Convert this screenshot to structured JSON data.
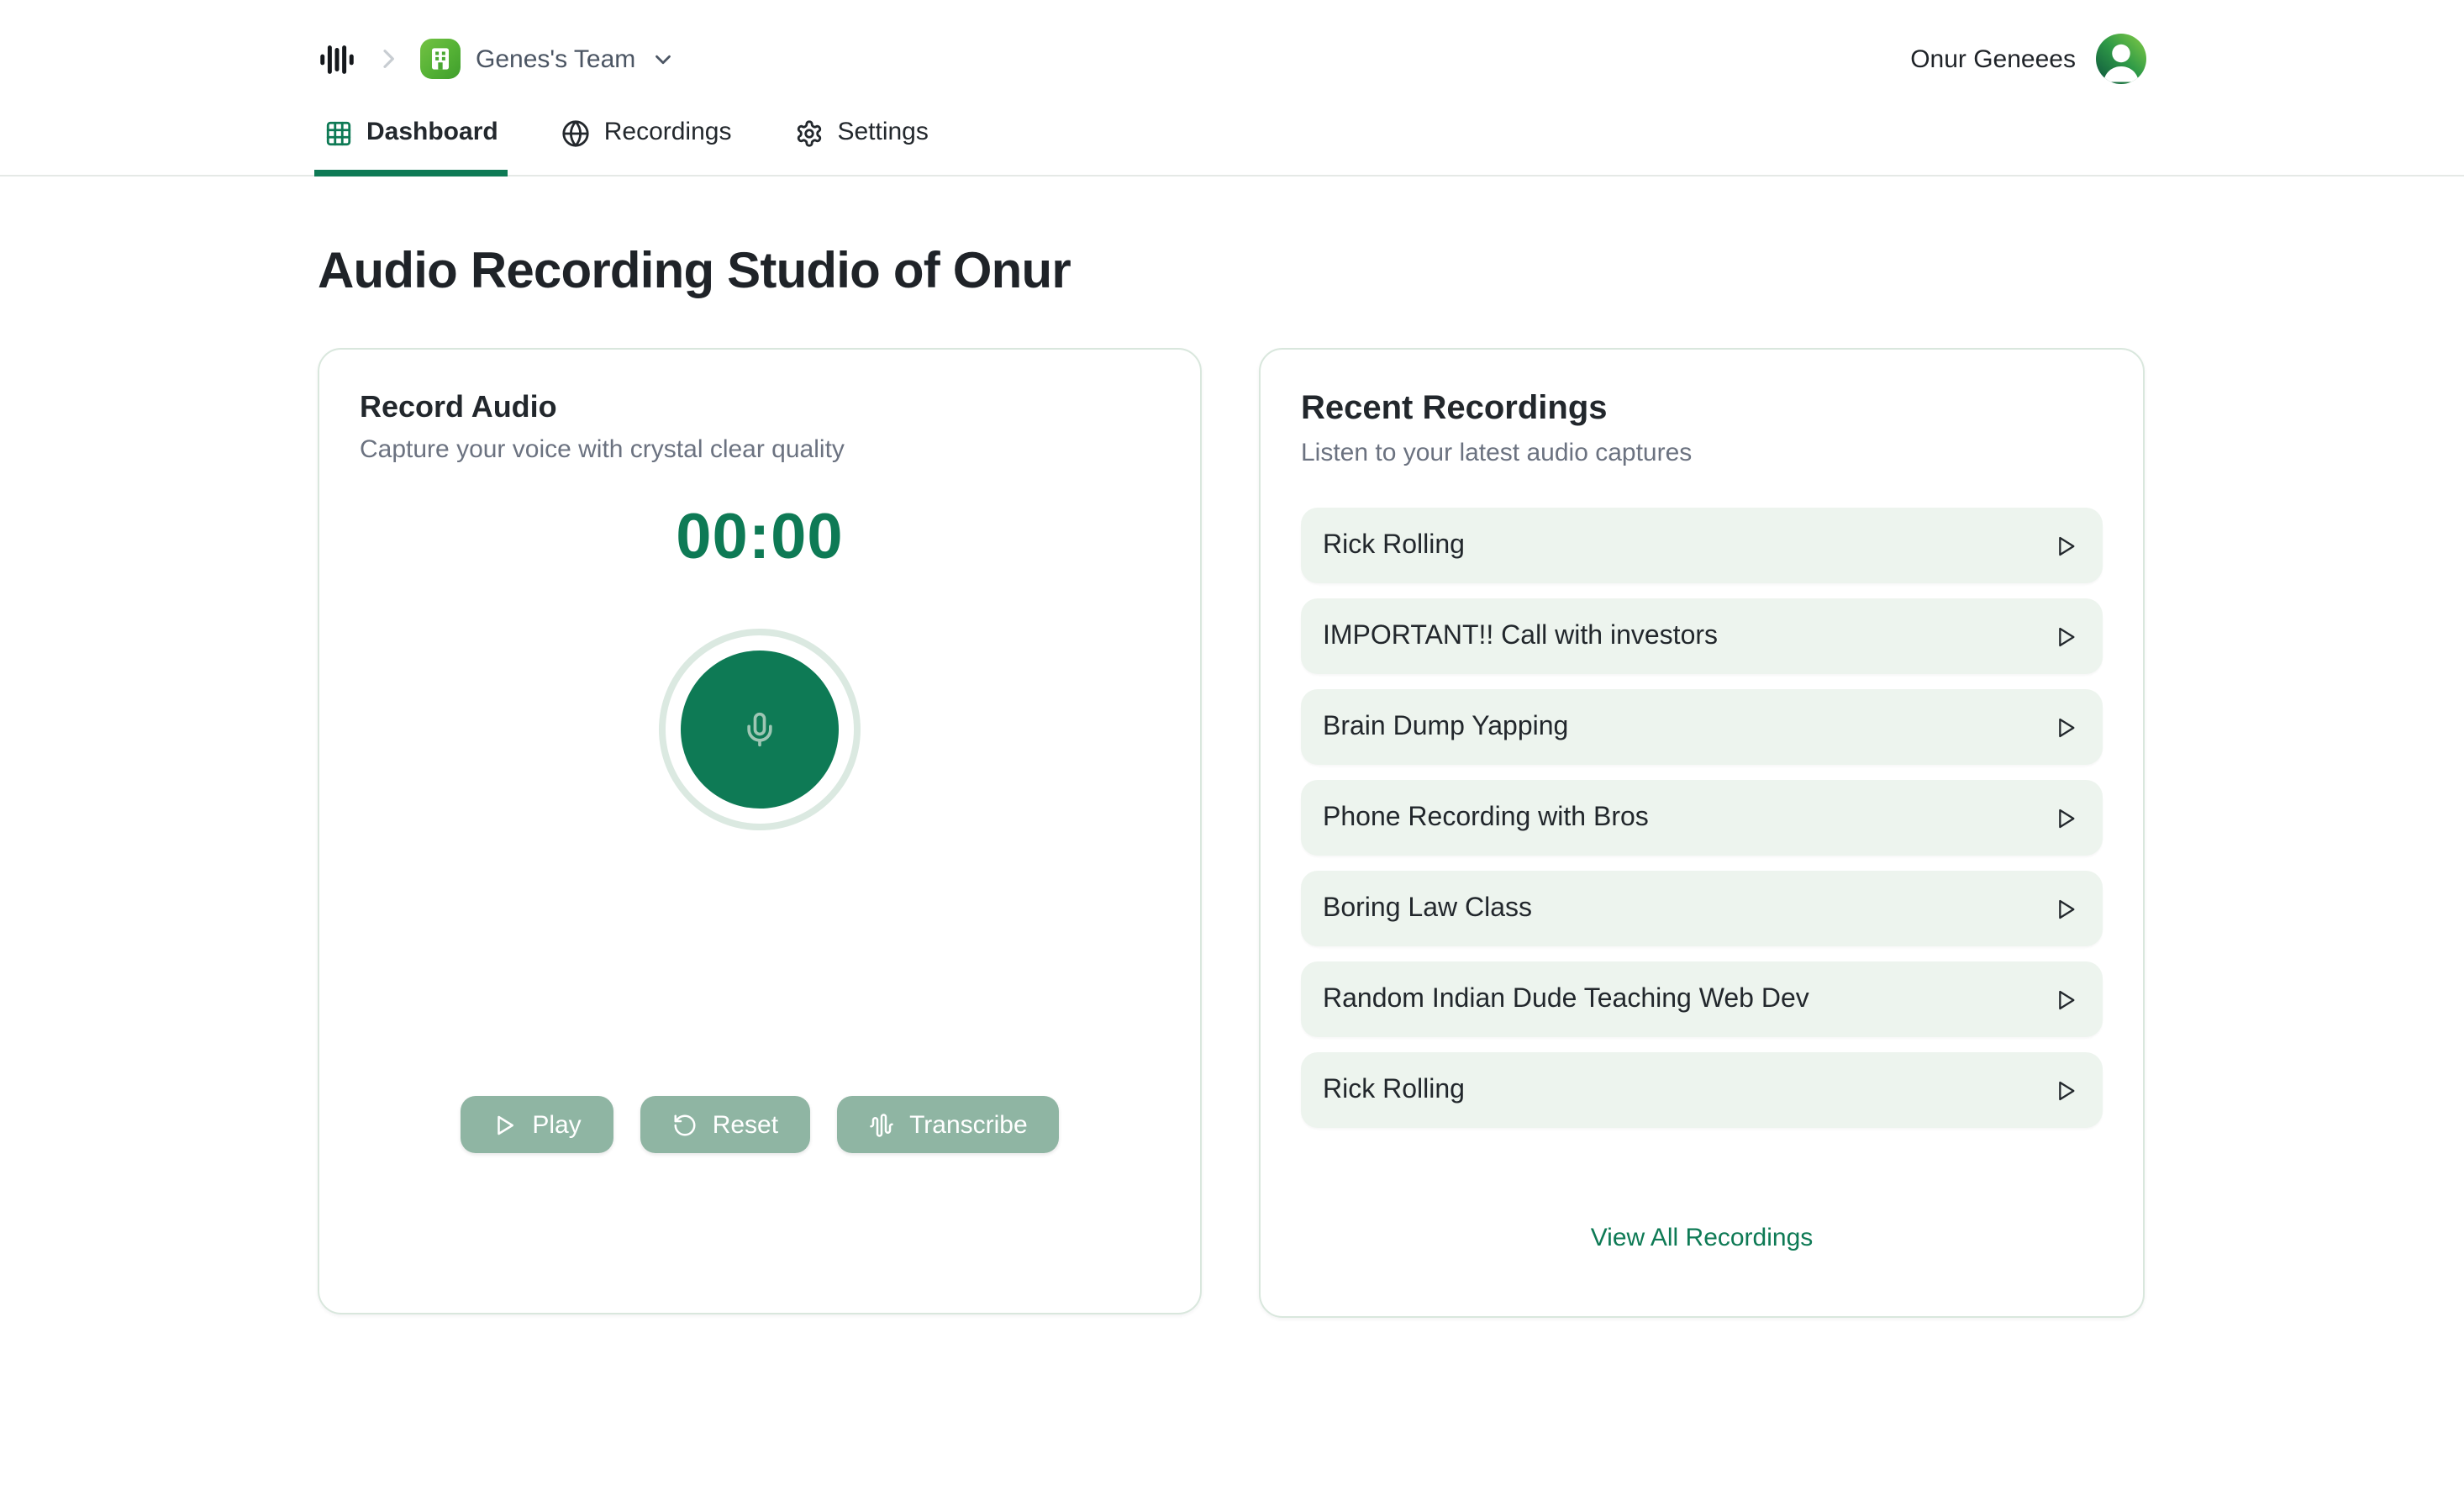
{
  "header": {
    "team_name": "Genes's Team",
    "user_name": "Onur Geneees"
  },
  "nav": {
    "tabs": [
      {
        "label": "Dashboard",
        "icon": "grid-icon",
        "active": true
      },
      {
        "label": "Recordings",
        "icon": "globe-icon",
        "active": false
      },
      {
        "label": "Settings",
        "icon": "gear-icon",
        "active": false
      }
    ]
  },
  "page_title": "Audio Recording Studio of Onur",
  "record_card": {
    "title": "Record Audio",
    "subtitle": "Capture your voice with crystal clear quality",
    "timer": "00:00",
    "record_button_icon": "microphone-icon",
    "buttons": [
      {
        "label": "Play",
        "icon": "play-icon"
      },
      {
        "label": "Reset",
        "icon": "rotate-ccw-icon"
      },
      {
        "label": "Transcribe",
        "icon": "audio-waveform-icon"
      }
    ]
  },
  "recordings_card": {
    "title": "Recent Recordings",
    "subtitle": "Listen to your latest audio captures",
    "item_play_icon": "play-icon",
    "items": [
      "Rick Rolling",
      "IMPORTANT!! Call with investors",
      "Brain Dump Yapping",
      "Phone Recording with Bros",
      "Boring Law Class",
      "Random Indian Dude Teaching Web Dev",
      "Rick Rolling"
    ],
    "view_all_label": "View All Recordings"
  },
  "colors": {
    "accent_green": "#0e7a55",
    "button_sage": "#8fb5a3",
    "item_bg": "#edf4ee",
    "card_border": "#d9e7dd",
    "badge_green": "#54b135",
    "text_dark": "#22272c",
    "text_gray": "#6b7280"
  }
}
